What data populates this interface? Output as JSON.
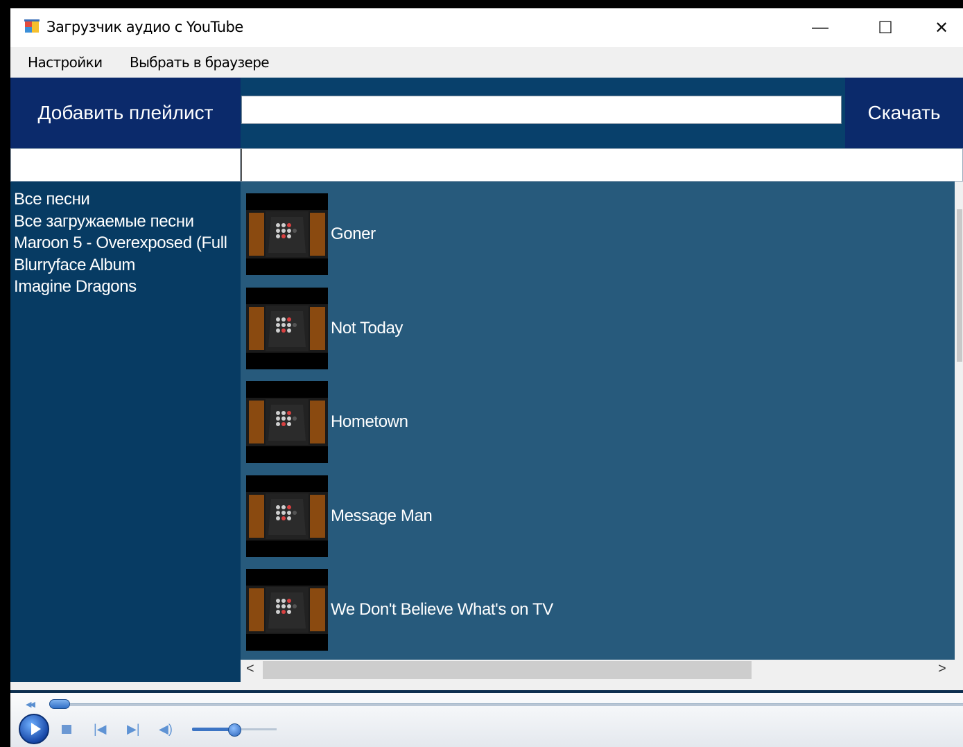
{
  "window": {
    "title": "Загрузчик аудио с YouTube",
    "controls": {
      "minimize": "—",
      "maximize": "☐",
      "close": "✕"
    }
  },
  "menu": {
    "settings": "Настройки",
    "browser": "Выбрать в браузере"
  },
  "toolbar": {
    "add_playlist": "Добавить плейлист",
    "url_value": "",
    "download": "Скачать"
  },
  "search": {
    "left_value": "",
    "right_value": ""
  },
  "playlists": [
    "Все песни",
    "Все загружаемые песни",
    "Maroon 5 - Overexposed (Full",
    "Blurryface Album",
    "Imagine Dragons"
  ],
  "songs": [
    {
      "title": "Goner"
    },
    {
      "title": "Not Today"
    },
    {
      "title": "Hometown"
    },
    {
      "title": "Message Man"
    },
    {
      "title": "We Don't Believe What's on TV"
    }
  ],
  "scrollbars": {
    "left_arrow": "<",
    "right_arrow": ">"
  },
  "player": {
    "seek_fraction": 0.0,
    "volume_fraction": 0.5
  },
  "colors": {
    "accent_dark_blue": "#0b2a6b",
    "sidebar_blue": "#073b63",
    "songs_blue": "#275a7c",
    "toolbar_strip": "#08406b"
  },
  "icons": {
    "app": "app-window-icon",
    "thumbnail": "album-cover-thumbnail",
    "player_play": "play-icon",
    "player_stop": "stop-icon",
    "player_prev": "previous-track-icon",
    "player_next": "next-track-icon",
    "player_volume": "volume-icon"
  }
}
